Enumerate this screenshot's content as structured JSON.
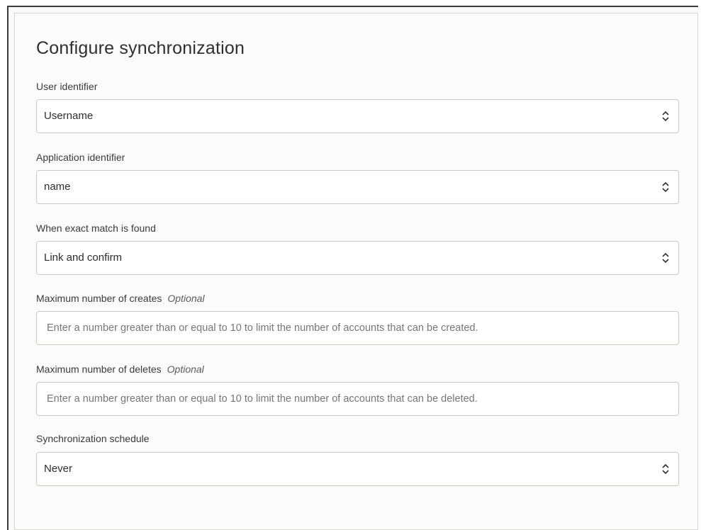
{
  "form": {
    "title": "Configure synchronization",
    "user_identifier": {
      "label": "User identifier",
      "value": "Username"
    },
    "application_identifier": {
      "label": "Application identifier",
      "value": "name"
    },
    "exact_match": {
      "label": "When exact match is found",
      "value": "Link and confirm"
    },
    "max_creates": {
      "label": "Maximum number of creates",
      "optional": "Optional",
      "placeholder": "Enter a number greater than or equal to 10 to limit the number of accounts that can be created."
    },
    "max_deletes": {
      "label": "Maximum number of deletes",
      "optional": "Optional",
      "placeholder": "Enter a number greater than or equal to 10 to limit the number of accounts that can be deleted."
    },
    "schedule": {
      "label": "Synchronization schedule",
      "value": "Never"
    }
  },
  "icons": {
    "select_arrow": "up-down-chevron-icon"
  }
}
